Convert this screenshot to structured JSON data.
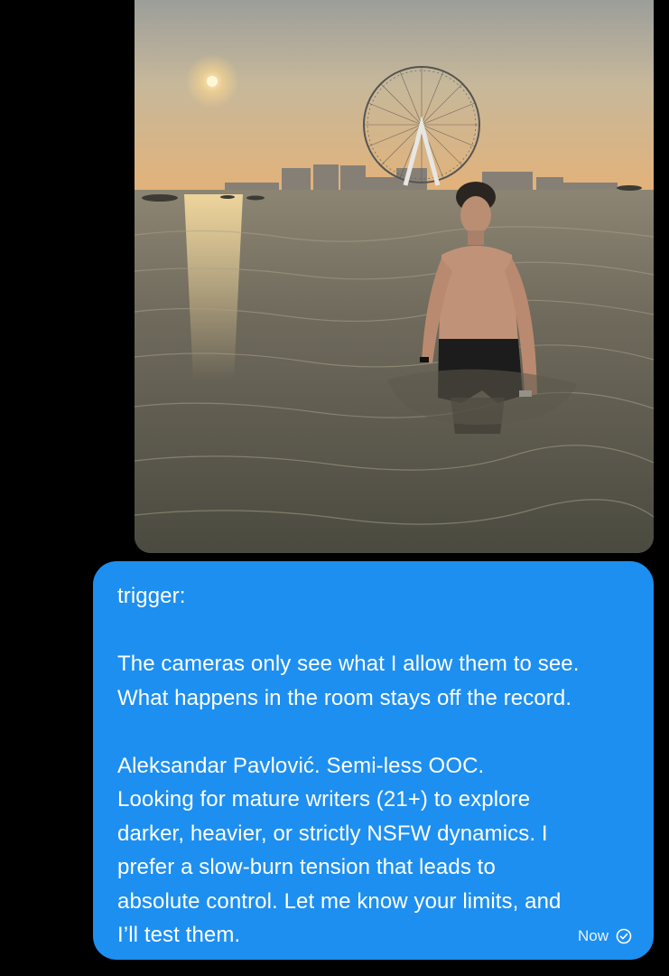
{
  "chat": {
    "photo": {
      "icon": "photo-attachment"
    },
    "message": {
      "lines": [
        "trigger:",
        "The cameras only see what I allow them to see.\nWhat happens in the room stays off the record.",
        "Aleksandar Pavlović. Semi-less OOC.\nLooking for mature writers (21+) to explore\ndarker, heavier, or strictly NSFW dynamics. I\nprefer a slow-burn tension that leads to\nabsolute control. Let me know your limits, and\nI’ll test them."
      ],
      "timestamp": "Now",
      "status_icon": "sent-check-icon"
    }
  },
  "colors": {
    "background": "#000000",
    "bubble": "#1d8ff0",
    "text": "#ffffff"
  }
}
